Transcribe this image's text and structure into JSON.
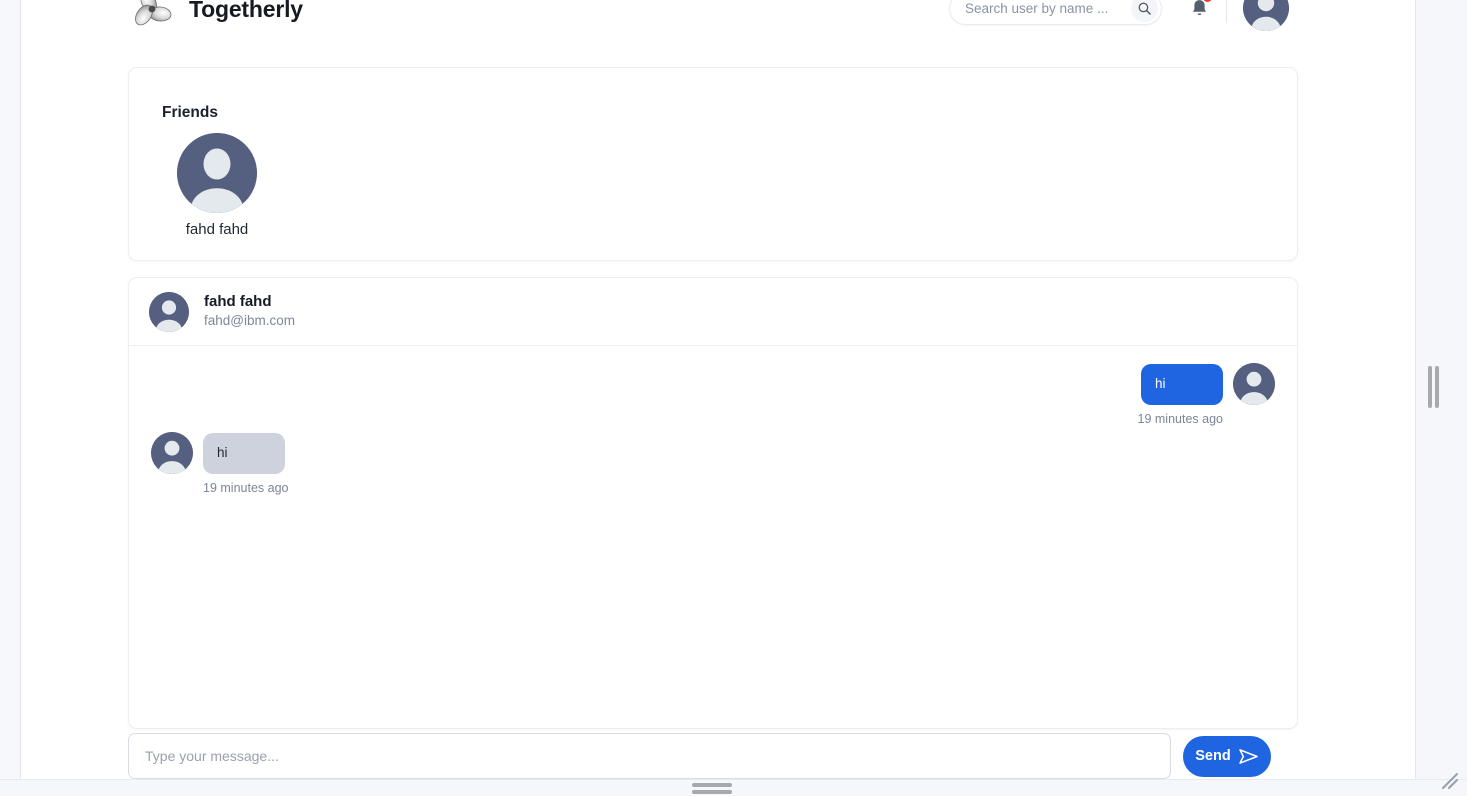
{
  "app": {
    "title": "Togetherly",
    "logo_icon": "propeller-logo-icon"
  },
  "topbar": {
    "search": {
      "placeholder": "Search user by name ...",
      "value": "",
      "icon": "search-icon"
    },
    "notifications": {
      "icon": "bell-icon",
      "has_unread": true,
      "badge_color": "#f5372b"
    },
    "profile_avatar_icon": "user-avatar-icon"
  },
  "friends": {
    "heading": "Friends",
    "items": [
      {
        "name": "fahd fahd",
        "avatar_icon": "user-avatar-icon"
      }
    ]
  },
  "chat": {
    "header": {
      "name": "fahd fahd",
      "email": "fahd@ibm.com",
      "avatar_icon": "user-avatar-icon"
    },
    "messages": [
      {
        "direction": "out",
        "text": "hi",
        "time": "19 minutes ago",
        "avatar_icon": "user-avatar-icon",
        "bubble_color": "#1f64e0",
        "text_color": "#ffffff"
      },
      {
        "direction": "in",
        "text": "hi",
        "time": "19 minutes ago",
        "avatar_icon": "user-avatar-icon",
        "bubble_color": "#ced2dd",
        "text_color": "#232733"
      }
    ]
  },
  "composer": {
    "placeholder": "Type your message...",
    "value": "",
    "send_label": "Send",
    "send_icon": "send-arrow-icon",
    "send_color": "#1f64e0"
  },
  "chrome": {
    "vertical_scroll_handle_icon": "vertical-drag-handle-icon",
    "horizontal_scroll_handle_icon": "horizontal-drag-handle-icon",
    "resize_grip_icon": "resize-grip-icon"
  },
  "theme": {
    "accent": "#1f64e0",
    "avatar_bg": "#555f7f",
    "avatar_fg": "#e3e9ec",
    "page_bg": "#ffffff",
    "chrome_bg": "#f5f7fb"
  }
}
